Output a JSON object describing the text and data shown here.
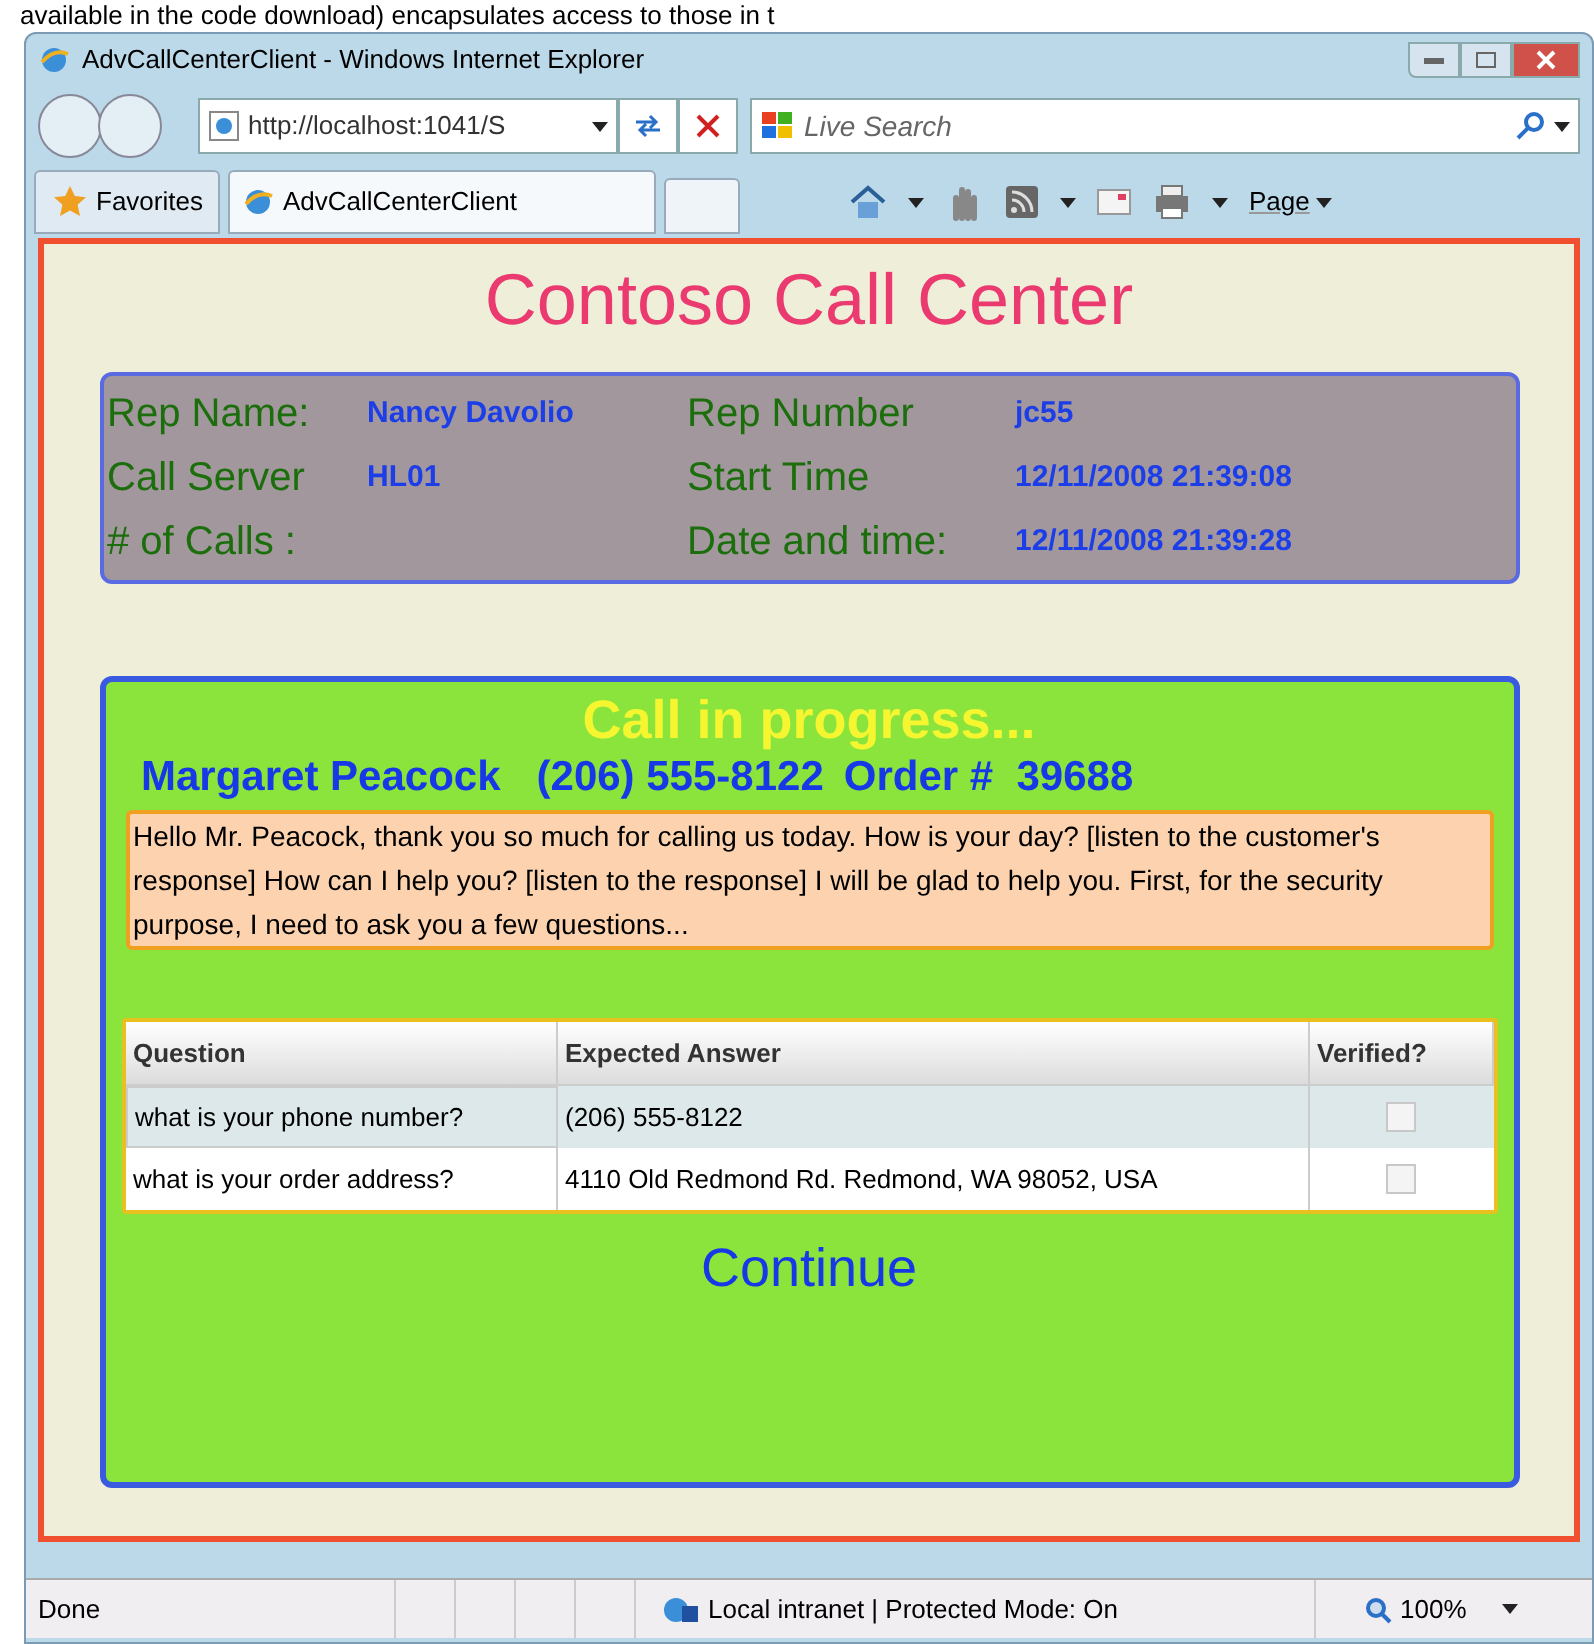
{
  "caption_fragment": "available in the code download) encapsulates access to those in t",
  "window": {
    "title": "AdvCallCenterClient - Windows Internet Explorer"
  },
  "address_bar": {
    "value": "http://localhost:1041/S"
  },
  "search": {
    "placeholder": "Live Search"
  },
  "favorites": {
    "label": "Favorites"
  },
  "tabs": [
    {
      "label": "AdvCallCenterClient",
      "selected": true
    }
  ],
  "toolbar": {
    "page_menu": "Page"
  },
  "page": {
    "title": "Contoso Call Center",
    "info": [
      {
        "label": "Rep Name:",
        "value": "Nancy Davolio"
      },
      {
        "label": "Rep Number",
        "value": "jc55"
      },
      {
        "label": "Call Server",
        "value": "HL01"
      },
      {
        "label": "Start Time",
        "value": "12/11/2008 21:39:08"
      },
      {
        "label": "# of Calls :"
      },
      {
        "label": "Date and time:",
        "value": "12/11/2008 21:39:28"
      }
    ],
    "call": {
      "status": "Call in progress...",
      "customer": "Margaret Peacock",
      "phone": "(206) 555-8122",
      "order_label": "Order #",
      "order": "39688",
      "script": "Hello Mr. Peacock, thank you so much for calling us today. How is your day? [listen to the customer's response] How can I help you? [listen to the response] I will be glad to help you. First, for the security purpose, I need to ask you a few questions...",
      "table": {
        "columns": [
          "Question",
          "Expected Answer",
          "Verified?"
        ],
        "rows": [
          {
            "question": "what is your phone number?",
            "answer": "(206) 555-8122",
            "verified": false,
            "selected": true
          },
          {
            "question": "what is your order address?",
            "answer": "4110 Old Redmond Rd. Redmond, WA 98052, USA",
            "verified": false,
            "selected": false
          }
        ]
      },
      "continue": "Continue"
    }
  },
  "status_bar": {
    "status": "Done",
    "zone": "Local intranet | Protected Mode: On",
    "zoom": "100%"
  }
}
